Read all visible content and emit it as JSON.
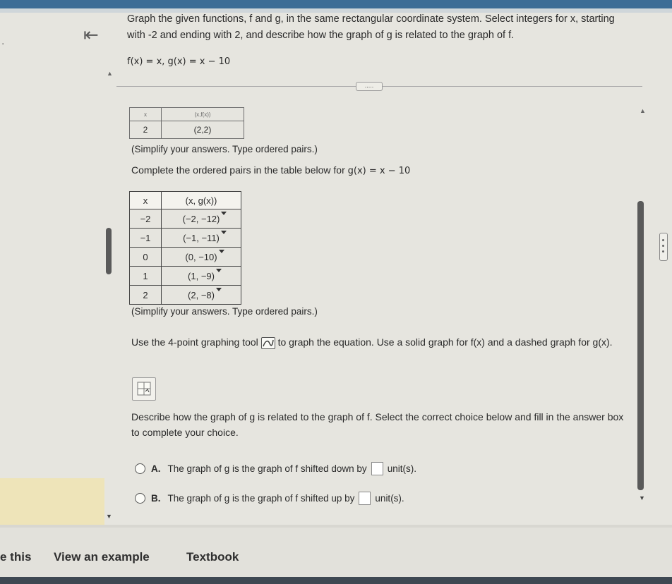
{
  "question": {
    "text": "Graph the given functions, f and g, in the same rectangular coordinate system. Select integers for x, starting with -2 and ending with 2, and describe how the graph of g is related to the graph of f.",
    "functions": "f(x) = x, g(x) = x − 10",
    "ellipsis": "....."
  },
  "table1": {
    "header": [
      "x",
      "(x,f(x))"
    ],
    "rows": [
      [
        "2",
        "(2,2)"
      ]
    ],
    "caption": "(Simplify your answers. Type ordered pairs.)"
  },
  "table2": {
    "prompt_prefix": "Complete the ordered pairs in the table below for",
    "prompt_func": "g(x) = x − 10",
    "headers": [
      "x",
      "(x, g(x))"
    ],
    "rows": [
      [
        "−2",
        "(−2, −12)"
      ],
      [
        "−1",
        "(−1, −11)"
      ],
      [
        "0",
        "(0, −10)"
      ],
      [
        "1",
        "(1, −9)"
      ],
      [
        "2",
        "(2, −8)"
      ]
    ],
    "caption": "(Simplify your answers. Type ordered pairs.)"
  },
  "instruction": {
    "prefix": "Use the 4-point graphing tool",
    "suffix": "to graph the equation. Use a solid graph for f(x) and a dashed graph for g(x)."
  },
  "describe": {
    "text": "Describe how the graph of g is related to the graph of f. Select the correct choice below and fill in the answer box to complete your choice.",
    "choice_a": {
      "letter": "A.",
      "before": "The graph of g is the graph of f shifted down by",
      "after": "unit(s)."
    },
    "choice_b": {
      "letter": "B.",
      "before": "The graph of g is the graph of f shifted up by",
      "after": "unit(s)."
    }
  },
  "footer": {
    "left_partial": "e this",
    "example": "View an example",
    "textbook": "Textbook"
  },
  "icons": [
    "back-arrow-icon",
    "graph-tool-icon",
    "grid-icon",
    "expand-icon",
    "collapse-icon"
  ]
}
